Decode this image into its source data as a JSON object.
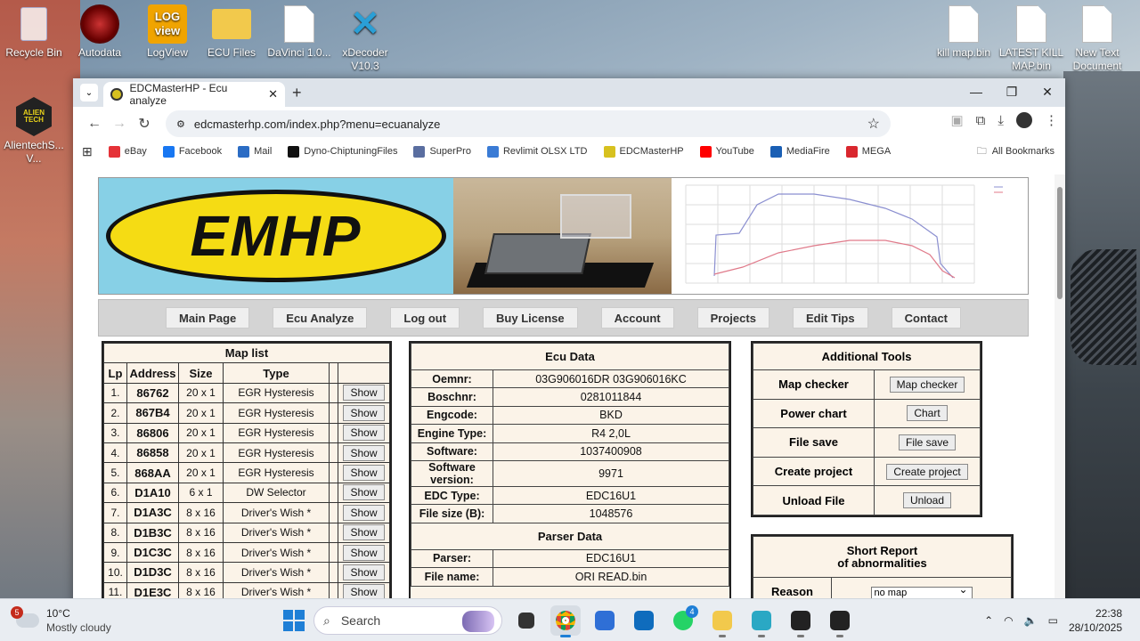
{
  "desktop": {
    "icons_left": [
      {
        "label": "Recycle Bin",
        "icon": "recycle-bin-icon"
      },
      {
        "label": "Autodata",
        "icon": "autodata-icon"
      },
      {
        "label": "LogView",
        "icon": "logview-icon",
        "logo_text": "LOG view"
      },
      {
        "label": "ECU Files",
        "icon": "folder-icon"
      },
      {
        "label": "DaVinci 1.0...",
        "icon": "file-icon"
      },
      {
        "label": "xDecoder V10.3",
        "icon": "xdecoder-icon"
      }
    ],
    "icons_right": [
      {
        "label": "kill map.bin",
        "icon": "file-icon"
      },
      {
        "label": "LATEST KILL MAP.bin",
        "icon": "file-icon"
      },
      {
        "label": "New Text Document",
        "icon": "file-icon"
      }
    ],
    "alientech": {
      "label": "AlientechS... V...",
      "logo_text": "ALIEN TECH"
    }
  },
  "browser": {
    "tab_title": "EDCMasterHP - Ecu analyze",
    "url": "edcmasterhp.com/index.php?menu=ecuanalyze",
    "bookmarks": [
      {
        "label": "eBay",
        "color": "#e53238"
      },
      {
        "label": "Facebook",
        "color": "#1877f2"
      },
      {
        "label": "Mail",
        "color": "#2b6cc4"
      },
      {
        "label": "Dyno-ChiptuningFiles",
        "color": "#111111"
      },
      {
        "label": "SuperPro",
        "color": "#5a6ea0"
      },
      {
        "label": "Revlimit OLSX LTD",
        "color": "#3a7bd5"
      },
      {
        "label": "EDCMasterHP",
        "color": "#d7c11f"
      },
      {
        "label": "YouTube",
        "color": "#ff0000"
      },
      {
        "label": "MediaFire",
        "color": "#1a5fb4"
      },
      {
        "label": "MEGA",
        "color": "#d9272e"
      }
    ],
    "all_bookmarks": "All Bookmarks"
  },
  "page": {
    "logo_text": "EMHP",
    "nav": [
      "Main Page",
      "Ecu Analyze",
      "Log out",
      "Buy License",
      "Account",
      "Projects",
      "Edit Tips",
      "Contact"
    ],
    "map_list": {
      "title": "Map list",
      "headers": [
        "Lp",
        "Address",
        "Size",
        "Type"
      ],
      "rows": [
        {
          "lp": "1.",
          "address": "86762",
          "size": "20 x 1",
          "type": "EGR Hysteresis",
          "action": "Show"
        },
        {
          "lp": "2.",
          "address": "867B4",
          "size": "20 x 1",
          "type": "EGR Hysteresis",
          "action": "Show"
        },
        {
          "lp": "3.",
          "address": "86806",
          "size": "20 x 1",
          "type": "EGR Hysteresis",
          "action": "Show"
        },
        {
          "lp": "4.",
          "address": "86858",
          "size": "20 x 1",
          "type": "EGR Hysteresis",
          "action": "Show"
        },
        {
          "lp": "5.",
          "address": "868AA",
          "size": "20 x 1",
          "type": "EGR Hysteresis",
          "action": "Show"
        },
        {
          "lp": "6.",
          "address": "D1A10",
          "size": "6 x 1",
          "type": "DW Selector",
          "action": "Show"
        },
        {
          "lp": "7.",
          "address": "D1A3C",
          "size": "8 x 16",
          "type": "Driver's Wish *",
          "action": "Show"
        },
        {
          "lp": "8.",
          "address": "D1B3C",
          "size": "8 x 16",
          "type": "Driver's Wish *",
          "action": "Show"
        },
        {
          "lp": "9.",
          "address": "D1C3C",
          "size": "8 x 16",
          "type": "Driver's Wish *",
          "action": "Show"
        },
        {
          "lp": "10.",
          "address": "D1D3C",
          "size": "8 x 16",
          "type": "Driver's Wish *",
          "action": "Show"
        },
        {
          "lp": "11.",
          "address": "D1E3C",
          "size": "8 x 16",
          "type": "Driver's Wish *",
          "action": "Show"
        }
      ]
    },
    "ecu_data": {
      "title": "Ecu Data",
      "rows": [
        {
          "label": "Oemnr:",
          "value": "03G906016DR 03G906016KC"
        },
        {
          "label": "Boschnr:",
          "value": "0281011844"
        },
        {
          "label": "Engcode:",
          "value": "BKD"
        },
        {
          "label": "Engine Type:",
          "value": "R4 2,0L"
        },
        {
          "label": "Software:",
          "value": "1037400908"
        },
        {
          "label": "Software version:",
          "value": "9971"
        },
        {
          "label": "EDC Type:",
          "value": "EDC16U1"
        },
        {
          "label": "File size (B):",
          "value": "1048576"
        }
      ],
      "parser_title": "Parser Data",
      "parser_rows": [
        {
          "label": "Parser:",
          "value": "EDC16U1"
        },
        {
          "label": "File name:",
          "value": "ORI READ.bin"
        }
      ]
    },
    "tools": {
      "title": "Additional Tools",
      "rows": [
        {
          "label": "Map checker",
          "button": "Map checker"
        },
        {
          "label": "Power chart",
          "button": "Chart"
        },
        {
          "label": "File save",
          "button": "File save"
        },
        {
          "label": "Create project",
          "button": "Create project"
        },
        {
          "label": "Unload File",
          "button": "Unload"
        }
      ]
    },
    "short_report": {
      "title_line1": "Short Report",
      "title_line2": "of abnormalities",
      "reason_label": "Reason",
      "reason_value": "no map"
    }
  },
  "taskbar": {
    "weather_temp": "10°C",
    "weather_desc": "Mostly cloudy",
    "weather_badge": "5",
    "search_placeholder": "Search",
    "whatsapp_badge": "4",
    "time": "22:38",
    "date": "28/10/2025"
  },
  "colors": {
    "accent_yellow": "#f5dc14",
    "logo_bg": "#87d0e6",
    "panel_bg": "#fbf3e8"
  }
}
